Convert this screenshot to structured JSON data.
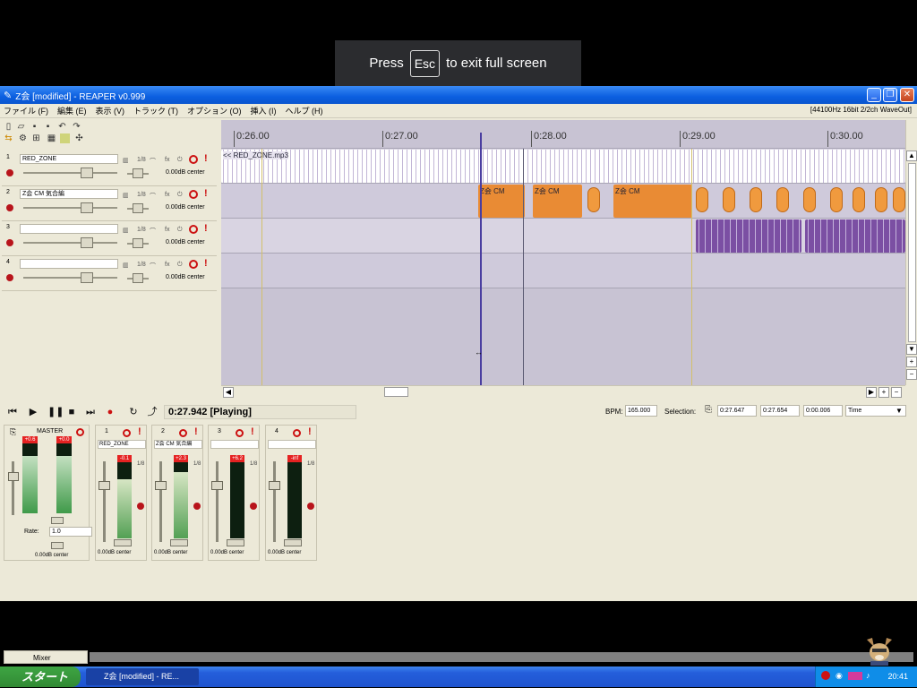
{
  "toast": {
    "press": "Press",
    "key": "Esc",
    "suffix": "to exit full screen"
  },
  "window": {
    "title": "Z会 [modified] - REAPER v0.999",
    "menu": [
      "ファイル (F)",
      "編集 (E)",
      "表示 (V)",
      "トラック (T)",
      "オプション (O)",
      "挿入 (I)",
      "ヘルプ (H)"
    ],
    "status": "[44100Hz 16bit 2/2ch WaveOut]"
  },
  "tracks": [
    {
      "num": "1",
      "name": "RED_ZONE",
      "io": "1/8",
      "fx": "fx",
      "vol": "0.00dB center"
    },
    {
      "num": "2",
      "name": "Z会 CM 気合編",
      "io": "1/8",
      "fx": "fx",
      "vol": "0.00dB center"
    },
    {
      "num": "3",
      "name": "",
      "io": "1/8",
      "fx": "fx",
      "vol": "0.00dB center"
    },
    {
      "num": "4",
      "name": "",
      "io": "1/8",
      "fx": "fx",
      "vol": "0.00dB center"
    }
  ],
  "ruler": {
    "ticks": [
      "0:26.00",
      "0:27.00",
      "0:28.00",
      "0:29.00",
      "0:30.00"
    ]
  },
  "clips": {
    "track1": "<< RED_ZONE.mp3",
    "track2": [
      "Z会 CM",
      "Z会 CM",
      "Z会 CM"
    ]
  },
  "transport": {
    "time": "0:27.942 [Playing]",
    "bpm_label": "BPM:",
    "bpm": "165.000",
    "selection_label": "Selection:",
    "sel_start": "0:27.647",
    "sel_end": "0:27.654",
    "sel_len": "0:00.006",
    "time_mode": "Time"
  },
  "mixer": {
    "master_label": "MASTER",
    "rate_label": "Rate:",
    "rate_value": "1.0",
    "master_vol": "0.00dB center",
    "master_peaks": [
      "+0.6",
      "+0.0"
    ],
    "tab_label": "Mixer",
    "strips": [
      {
        "num": "1",
        "name": "RED_ZONE",
        "peak": "-0.1",
        "io": "1/8",
        "vol": "0.00dB center",
        "level": 0.72
      },
      {
        "num": "2",
        "name": "Z会 CM 気合編",
        "peak": "+2.3",
        "io": "1/8",
        "vol": "0.00dB center",
        "level": 0.8
      },
      {
        "num": "3",
        "name": "",
        "peak": "+6.2",
        "io": "1/8",
        "vol": "0.00dB center",
        "level": 0.0
      },
      {
        "num": "4",
        "name": "",
        "peak": "-inf",
        "io": "1/8",
        "vol": "0.00dB center",
        "level": 0.0
      }
    ]
  },
  "taskbar": {
    "start": "スタート",
    "task": "Z会 [modified] - RE...",
    "clock": "20:41"
  },
  "colors": {
    "title_blue": "#0b5fe0",
    "clip_orange": "#e98b34",
    "clip_purple": "#7b4fa3",
    "playhead": "#4a3ea0",
    "taskbar_blue": "#245edb",
    "start_green": "#3ea543"
  }
}
